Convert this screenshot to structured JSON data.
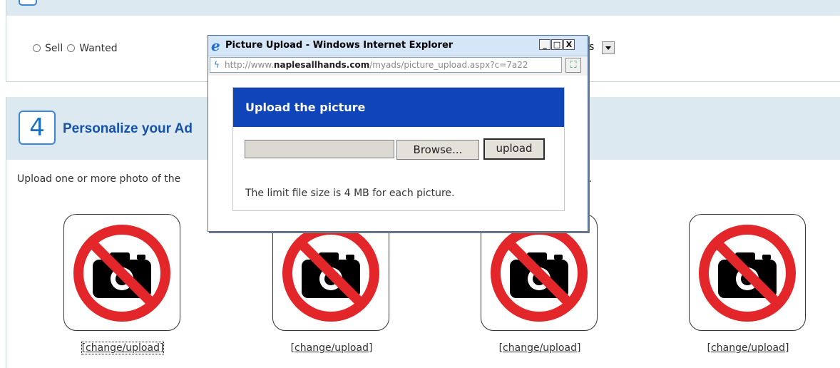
{
  "page": {
    "ad_type": {
      "options": [
        "Sell",
        "Wanted"
      ]
    },
    "category_select": {
      "value_fragment": "s"
    },
    "section4": {
      "step_number": "4",
      "title_fragment": "Personalize your Ad",
      "instructions_fragment": "Upload one or more photo of the",
      "instructions_tail": "."
    },
    "photo_slots": [
      {
        "link": "[change/upload]"
      },
      {
        "link": "[change/upload]"
      },
      {
        "link": "[change/upload]"
      },
      {
        "link": "[change/upload]"
      }
    ],
    "photo_placeholder_icon": "no-camera-icon"
  },
  "popup": {
    "title": "Picture Upload - Windows Internet Explorer",
    "window_buttons": {
      "minimize": "_",
      "maximize": "□",
      "close": "X"
    },
    "address": {
      "prefix": "http://www.",
      "domain": "naplesallhands.com",
      "path": "/myads/picture_upload.aspx?c=7a22"
    },
    "panel": {
      "header": "Upload the picture",
      "browse_label": "Browse...",
      "upload_label": "upload",
      "limit_text": "The limit file size is 4 MB for each picture."
    }
  },
  "colors": {
    "accent_blue": "#0f45b8",
    "section_band": "#dde9f1",
    "prohibition_red": "#e3262a"
  }
}
